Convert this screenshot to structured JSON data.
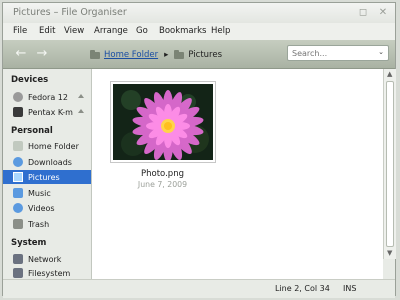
{
  "window": {
    "title": "Pictures – File Organiser"
  },
  "menubar": {
    "items": [
      "File",
      "Edit",
      "View",
      "Arrange",
      "Go",
      "Bookmarks",
      "Help"
    ]
  },
  "toolbar": {
    "path": [
      "Home Folder",
      "Pictures"
    ],
    "search_placeholder": "Search..."
  },
  "sidebar": {
    "devices_label": "Devices",
    "devices": [
      {
        "label": "Fedora 12",
        "icon": "disk-icon"
      },
      {
        "label": "Pentax K-m",
        "icon": "camera-icon"
      }
    ],
    "personal_label": "Personal",
    "personal": [
      {
        "label": "Home Folder",
        "icon": "home-icon"
      },
      {
        "label": "Downloads",
        "icon": "download-icon"
      },
      {
        "label": "Pictures",
        "icon": "pictures-icon",
        "selected": true
      },
      {
        "label": "Music",
        "icon": "music-icon"
      },
      {
        "label": "Videos",
        "icon": "video-icon"
      },
      {
        "label": "Trash",
        "icon": "trash-icon"
      }
    ],
    "system_label": "System",
    "system": [
      {
        "label": "Network",
        "icon": "network-icon"
      },
      {
        "label": "Filesystem",
        "icon": "filesystem-icon"
      }
    ]
  },
  "content": {
    "files": [
      {
        "name": "Photo.png",
        "date": "June 7, 2009"
      }
    ]
  },
  "statusbar": {
    "position": "Line 2, Col 34",
    "mode": "INS"
  },
  "colors": {
    "selection": "#2f6fcf",
    "toolbar": "#b5bdb0"
  }
}
